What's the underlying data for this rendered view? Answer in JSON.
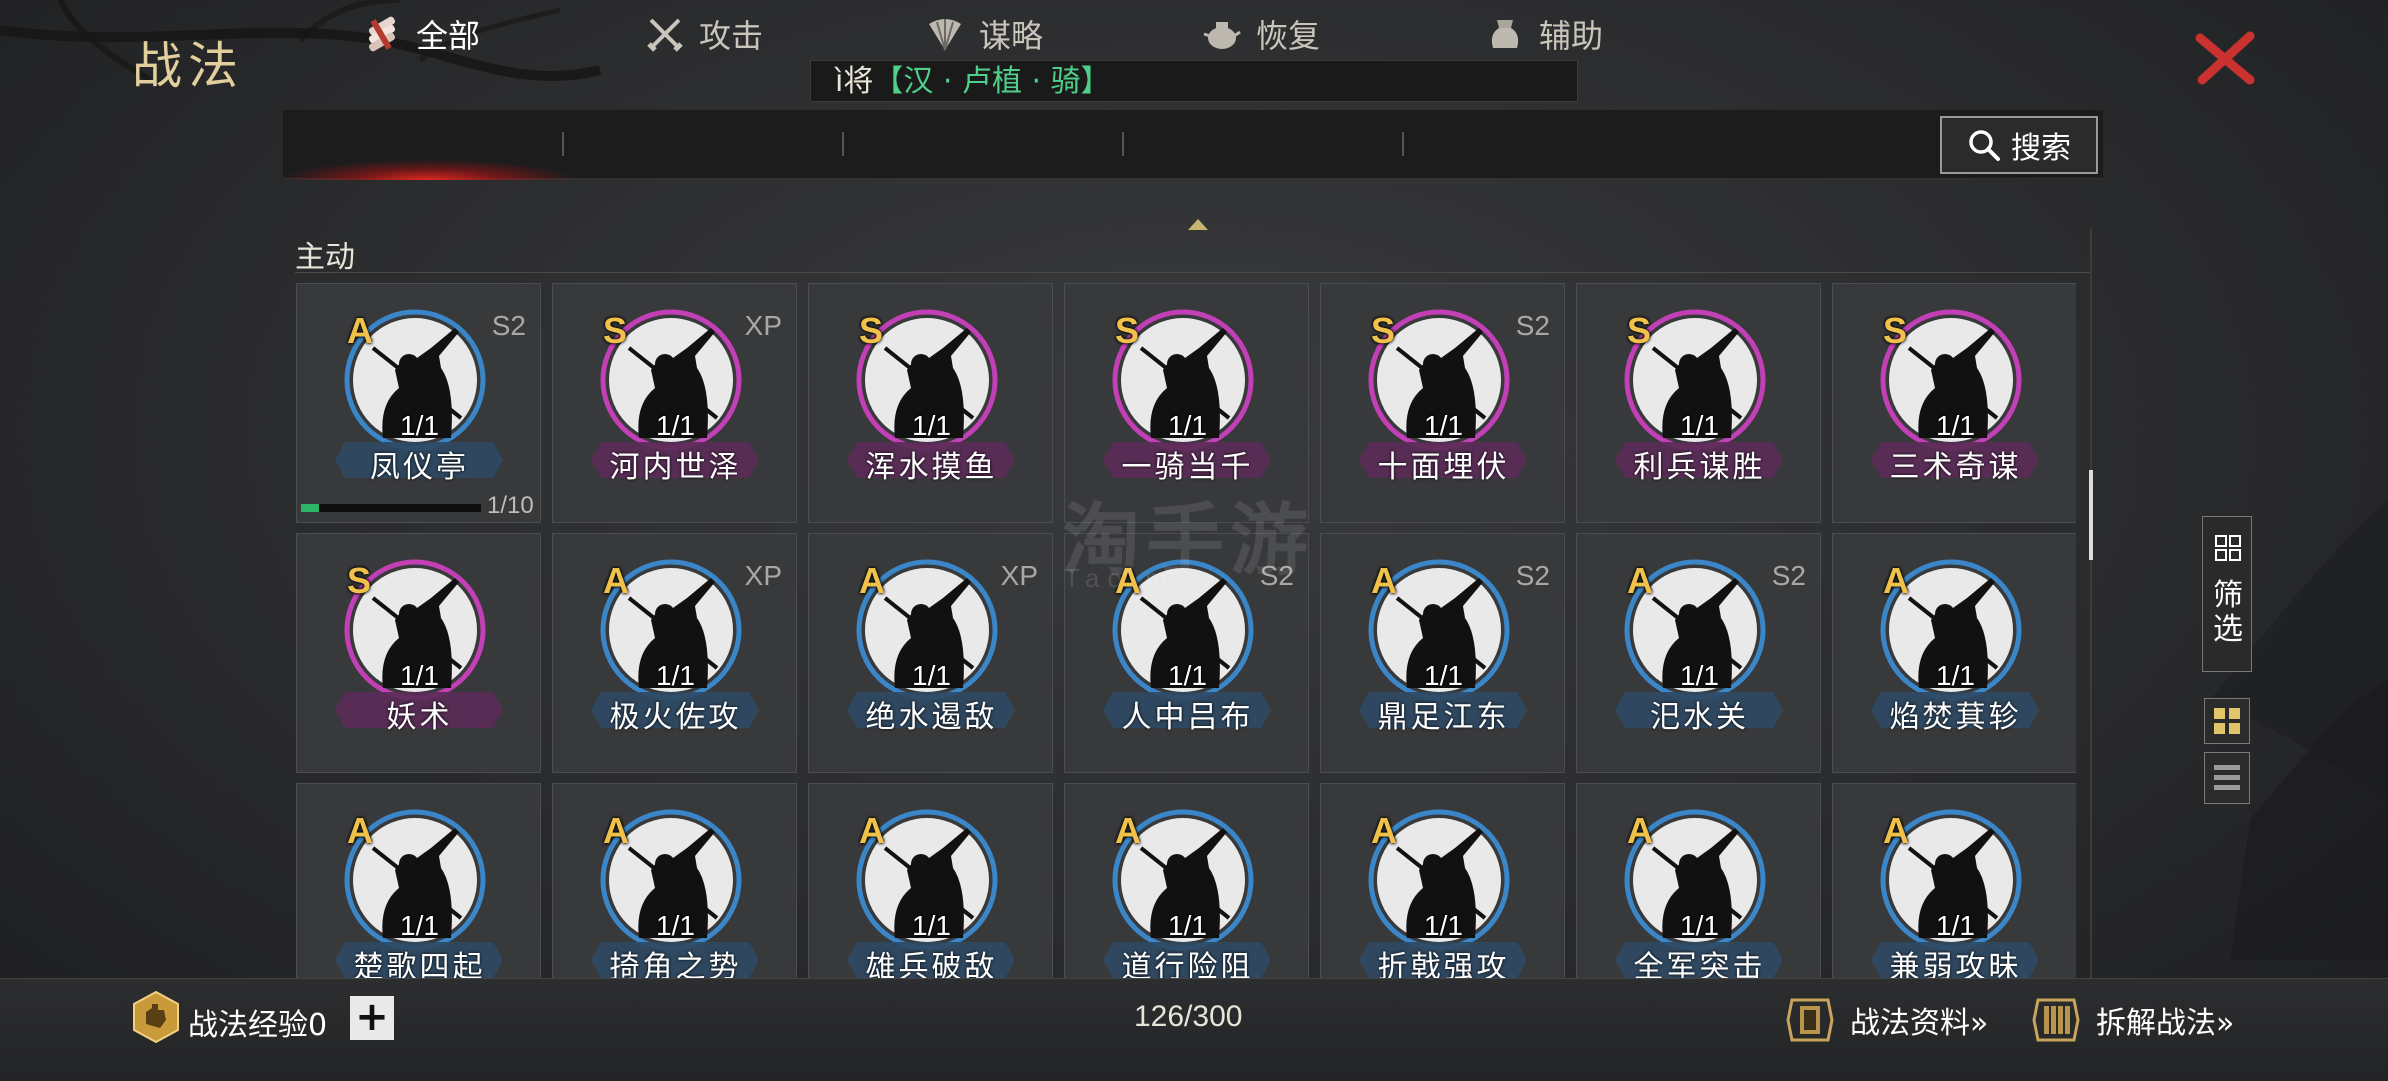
{
  "header": {
    "title": "战法",
    "general_prefix": "ì将",
    "general_name": "【汉 · 卢植 · 骑】"
  },
  "tabs": [
    {
      "label": "全部",
      "icon": "scroll-bundle-icon",
      "active": true
    },
    {
      "label": "攻击",
      "icon": "crossed-swords-icon"
    },
    {
      "label": "谋略",
      "icon": "feather-fan-icon"
    },
    {
      "label": "恢复",
      "icon": "medicine-pot-icon"
    },
    {
      "label": "辅助",
      "icon": "pouch-icon"
    }
  ],
  "search": {
    "label": "搜索"
  },
  "section": {
    "label": "主动"
  },
  "colors": {
    "grade_s_ring": "#c23fb6",
    "grade_a_ring": "#3b86c8",
    "accent_gold": "#e2cf9e",
    "progress": "#2fb567",
    "close": "#c9322f"
  },
  "tactics": [
    {
      "grade": "A",
      "tag": "S2",
      "count": "1/1",
      "name": "凤仪亭",
      "progress": {
        "value": 1,
        "max": 10,
        "text": "1/10"
      }
    },
    {
      "grade": "S",
      "tag": "XP",
      "count": "1/1",
      "name": "河内世泽"
    },
    {
      "grade": "S",
      "tag": "",
      "count": "1/1",
      "name": "浑水摸鱼"
    },
    {
      "grade": "S",
      "tag": "",
      "count": "1/1",
      "name": "一骑当千"
    },
    {
      "grade": "S",
      "tag": "S2",
      "count": "1/1",
      "name": "十面埋伏"
    },
    {
      "grade": "S",
      "tag": "",
      "count": "1/1",
      "name": "利兵谋胜"
    },
    {
      "grade": "S",
      "tag": "",
      "count": "1/1",
      "name": "三术奇谋"
    },
    {
      "grade": "S",
      "tag": "",
      "count": "1/1",
      "name": "妖术"
    },
    {
      "grade": "A",
      "tag": "XP",
      "count": "1/1",
      "name": "极火佐攻"
    },
    {
      "grade": "A",
      "tag": "XP",
      "count": "1/1",
      "name": "绝水遏敌"
    },
    {
      "grade": "A",
      "tag": "S2",
      "count": "1/1",
      "name": "人中吕布"
    },
    {
      "grade": "A",
      "tag": "S2",
      "count": "1/1",
      "name": "鼎足江东"
    },
    {
      "grade": "A",
      "tag": "S2",
      "count": "1/1",
      "name": "汜水关"
    },
    {
      "grade": "A",
      "tag": "",
      "count": "1/1",
      "name": "焰焚萁轸"
    },
    {
      "grade": "A",
      "tag": "",
      "count": "1/1",
      "name": "楚歌四起"
    },
    {
      "grade": "A",
      "tag": "",
      "count": "1/1",
      "name": "掎角之势"
    },
    {
      "grade": "A",
      "tag": "",
      "count": "1/1",
      "name": "雄兵破敌"
    },
    {
      "grade": "A",
      "tag": "",
      "count": "1/1",
      "name": "道行险阻"
    },
    {
      "grade": "A",
      "tag": "",
      "count": "1/1",
      "name": "折戟强攻"
    },
    {
      "grade": "A",
      "tag": "",
      "count": "1/1",
      "name": "全军突击"
    },
    {
      "grade": "A",
      "tag": "",
      "count": "1/1",
      "name": "兼弱攻昧"
    }
  ],
  "watermark": {
    "text": "淘手游",
    "sub": "Tao   m"
  },
  "side": {
    "filter_label": "筛\n选"
  },
  "footer": {
    "exp_label": "战法经验0",
    "plus": "+",
    "capacity": "126/300",
    "info_label": "战法资料»",
    "dismantle_label": "拆解战法»"
  }
}
